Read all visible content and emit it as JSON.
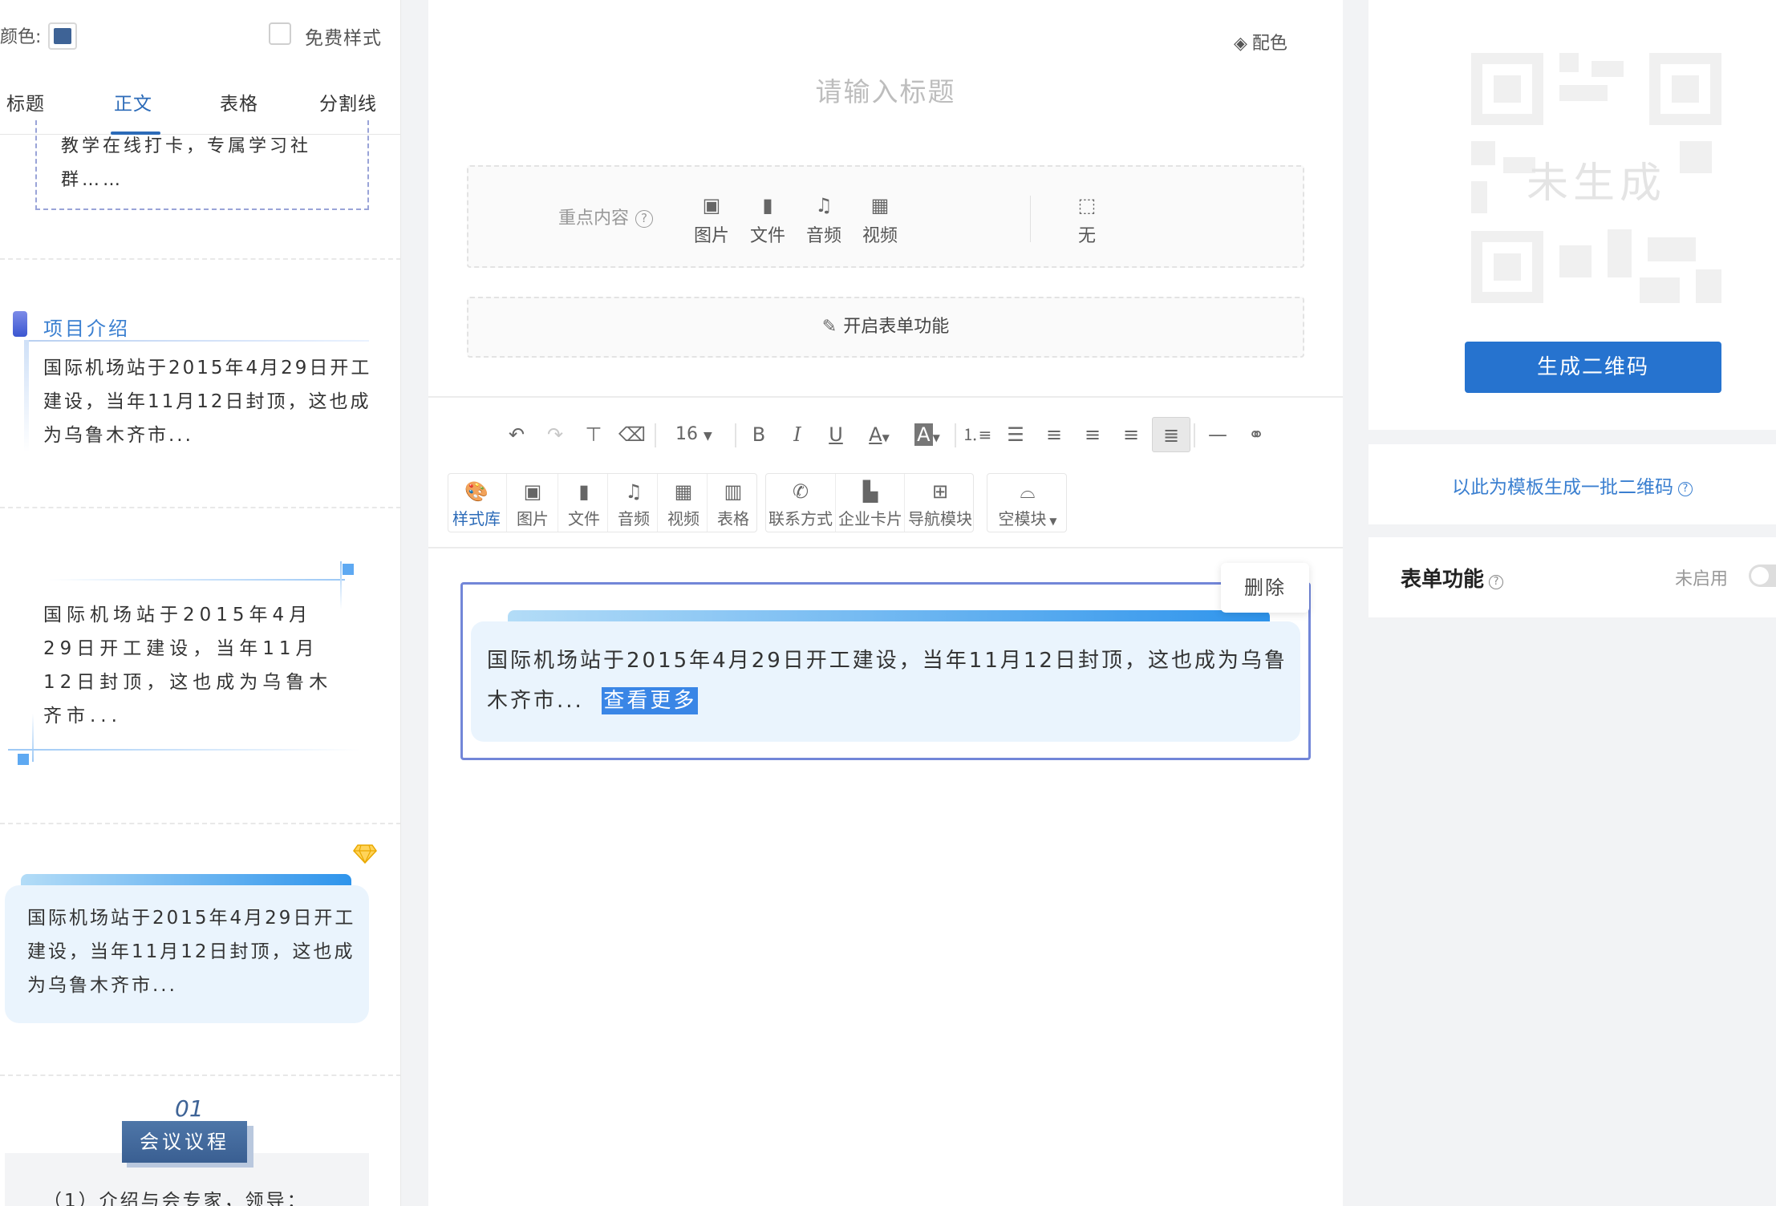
{
  "left_panel": {
    "color_label": "颜色:",
    "color_value": "#3e6396",
    "free_style_label": "免费样式",
    "free_style_checked": false,
    "tabs": [
      "标题",
      "正文",
      "表格",
      "分割线"
    ],
    "active_tab": "正文",
    "card1_text": "教学在线打卡，专属学习社群……",
    "card2_title": "项目介绍",
    "card2_text": "国际机场站于2015年4月29日开工建设，当年11月12日封顶，这也成为乌鲁木齐市...",
    "card3_text": "国际机场站于2015年4月29日开工建设，当年11月12日封顶，这也成为乌鲁木齐市...",
    "card4_text": "国际机场站于2015年4月29日开工建设，当年11月12日封顶，这也成为乌鲁木齐市...",
    "card5_num": "01",
    "card5_badge": "会议议程",
    "card5_text": "（1）介绍与会专家，领导："
  },
  "center": {
    "palette_label": "配色",
    "title_placeholder": "请输入标题",
    "key_content_label": "重点内容",
    "key_items": [
      "图片",
      "文件",
      "音频",
      "视频",
      "无"
    ],
    "form_toggle_label": "开启表单功能",
    "font_size": "16",
    "modules": {
      "group1": [
        "样式库",
        "图片",
        "文件",
        "音频",
        "视频",
        "表格"
      ],
      "group2": [
        "联系方式",
        "企业卡片",
        "导航模块"
      ],
      "group3": [
        "空模块"
      ]
    },
    "active_module": "样式库",
    "content_text": "国际机场站于2015年4月29日开工建设，当年11月12日封顶，这也成为乌鲁木齐市...",
    "more_label": "查看更多",
    "delete_label": "删除"
  },
  "right_panel": {
    "qr_placeholder": "未生成",
    "generate_button": "生成二维码",
    "batch_link": "以此为模板生成一批二维码",
    "form_label": "表单功能",
    "form_status": "未启用",
    "form_enabled": false
  }
}
